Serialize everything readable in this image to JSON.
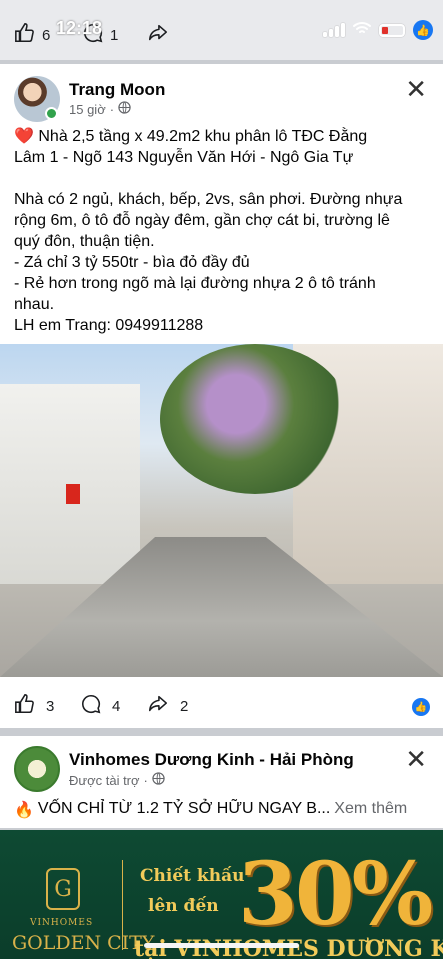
{
  "status": {
    "time": "12:18",
    "like_count": "6",
    "comment_count": "1"
  },
  "post": {
    "author": "Trang Moon",
    "time_ago": "15 giờ",
    "lines": [
      "❤️ Nhà 2,5 tầng x 49.2m2 khu phân lô TĐC Đằng",
      "Lâm 1 - Ngõ 143 Nguyễn Văn Hới - Ngô Gia Tự",
      "",
      "Nhà có 2 ngủ, khách, bếp, 2vs, sân phơi. Đường nhựa",
      "rộng 6m, ô tô đỗ ngày đêm, gần chợ cát bi, trường lê",
      "quý đôn, thuận tiện.",
      "- Zá chỉ 3 tỷ 550tr - bìa đỏ đầy đủ",
      "- Rẻ hơn trong ngõ mà lại đường nhựa 2 ô tô tránh",
      "nhau.",
      "LH em Trang: 0949911288"
    ],
    "likes": "3",
    "comments": "4",
    "shares": "2"
  },
  "ad": {
    "page_name": "Vinhomes Dương Kinh - Hải Phòng",
    "sponsored": "Được tài trợ",
    "text": "VỐN CHỈ TỪ 1.2 TỶ SỞ HỮU NGAY B...",
    "see_more": "Xem thêm",
    "banner": {
      "brand_small": "VINHOMES",
      "brand_big": "GOLDEN CITY",
      "line1": "Chiết khấu",
      "line2": "lên đến",
      "percent": "30%",
      "line3": "tại VINHOMES DƯƠNG KINH"
    }
  },
  "colors": {
    "accent": "#1877f2",
    "online": "#31a24c",
    "heart": "#e41e3f",
    "banner_bg": "#0e4a33",
    "gold": "#f0b43a"
  }
}
